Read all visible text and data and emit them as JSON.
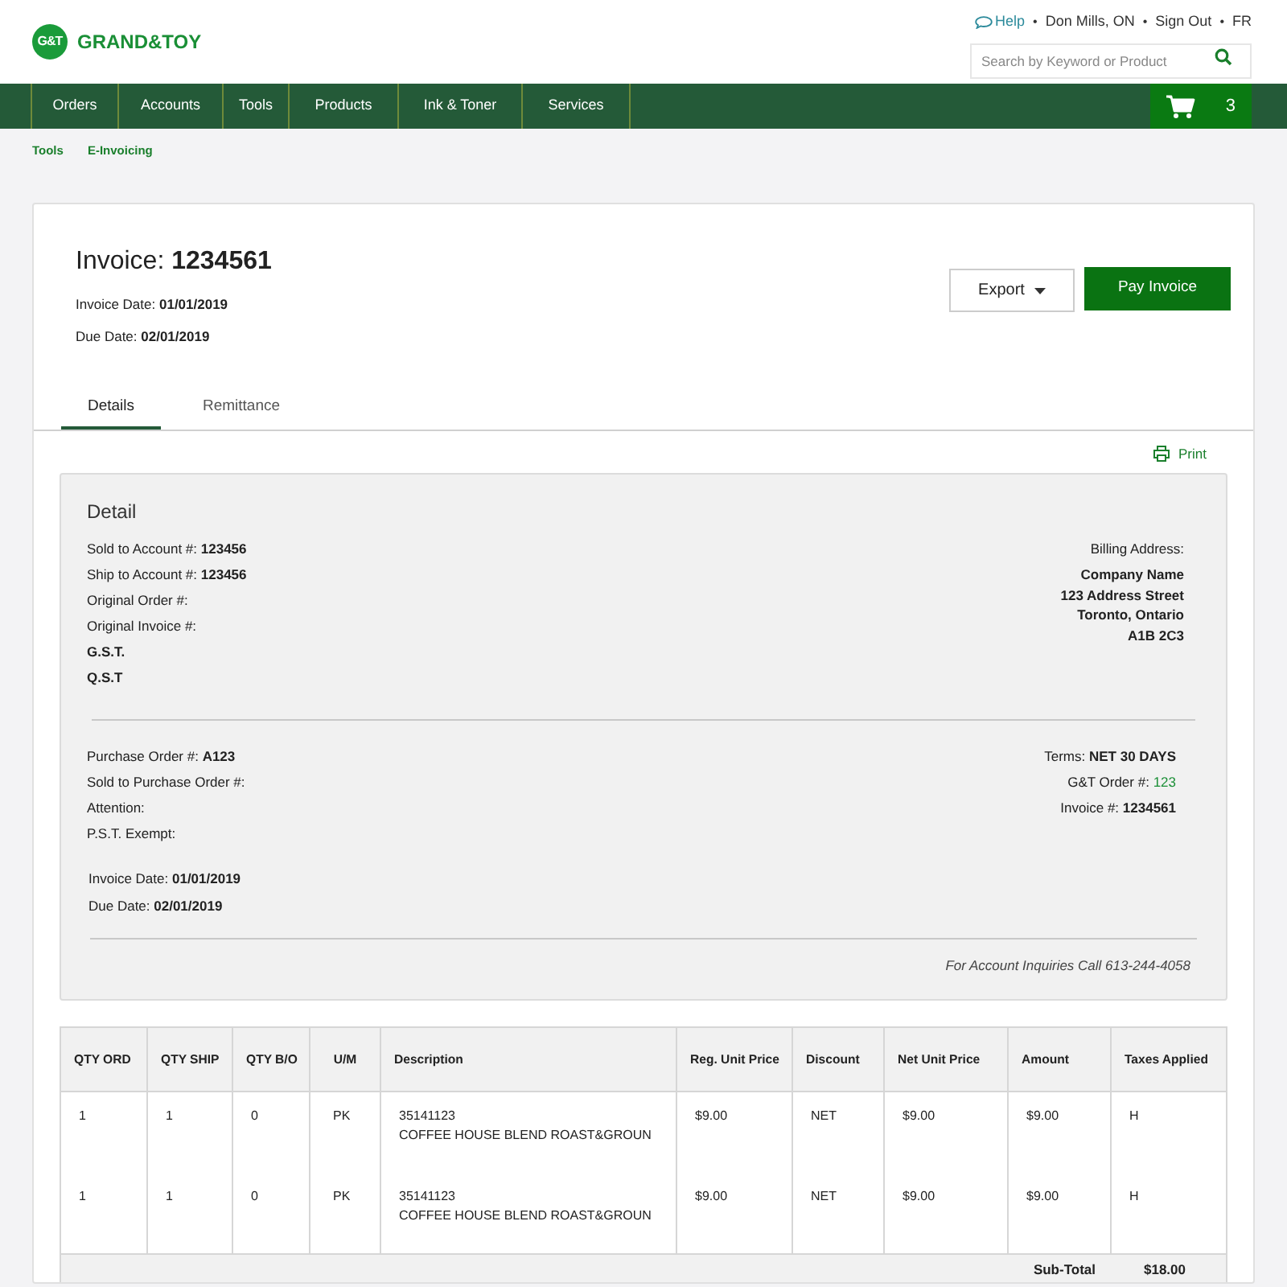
{
  "header": {
    "logo_mark": "G&T",
    "logo_text": "GRAND&TOY",
    "top_links": [
      {
        "label": "Help",
        "kind": "help"
      },
      {
        "label": "Don Mills, ON",
        "kind": "plain"
      },
      {
        "label": "Sign Out",
        "kind": "plain"
      },
      {
        "label": "FR",
        "kind": "plain"
      }
    ],
    "link_separator": "•",
    "search": {
      "placeholder": "Search by Keyword or Product"
    },
    "nav": [
      "Orders",
      "Accounts",
      "Tools",
      "Products",
      "Ink & Toner",
      "Services"
    ],
    "cart_count": "3"
  },
  "breadcrumbs": [
    "Tools",
    "E-Invoicing"
  ],
  "invoice": {
    "title_label": "Invoice:",
    "number": "1234561",
    "meta": [
      {
        "label": "Invoice Date:",
        "value": "01/01/2019"
      },
      {
        "label": "Due Date:",
        "value": "02/01/2019"
      }
    ],
    "export_button": "Export",
    "pay_button": "Pay Invoice",
    "tabs": [
      {
        "label": "Details",
        "selected": true
      },
      {
        "label": "Remittance",
        "selected": false
      }
    ],
    "print": "Print"
  },
  "detail": {
    "title": "Detail",
    "left_fields": [
      {
        "label": "Sold to Account #:",
        "value": "123456",
        "kind": "field"
      },
      {
        "label": "Ship to Account #:",
        "value": "123456",
        "kind": "field"
      },
      {
        "label": "Original Order #:",
        "kind": "field"
      },
      {
        "label": "Original Invoice #:",
        "kind": "field"
      },
      {
        "label": "G.S.T.",
        "kind": "heading"
      },
      {
        "label": "Q.S.T",
        "kind": "heading"
      }
    ],
    "billing_label": "Billing Address:",
    "billing_lines": [
      "Company Name",
      "123 Address Street",
      "Toronto, Ontario",
      "A1B 2C3"
    ],
    "order_fields": [
      {
        "label": "Purchase Order #:",
        "value": "A123",
        "kind": "field"
      },
      {
        "label": "Sold to Purchase Order #:",
        "kind": "field"
      },
      {
        "label": "Attention:",
        "kind": "field"
      },
      {
        "label": "P.S.T. Exempt:",
        "kind": "field"
      }
    ],
    "right_fields": [
      {
        "label": "Terms:",
        "value": "NET 30 DAYS",
        "kind": "field"
      },
      {
        "label": "G&T Order #:",
        "value": "123",
        "kind": "link"
      },
      {
        "label": "Invoice #:",
        "value": "1234561",
        "kind": "field"
      }
    ],
    "dates": [
      {
        "label": "Invoice Date:",
        "value": "01/01/2019",
        "kind": "field"
      },
      {
        "label": "Due Date:",
        "value": "02/01/2019",
        "kind": "field"
      }
    ],
    "note": "For Account Inquiries Call 613-244-4058"
  },
  "table": {
    "columns": [
      "QTY ORD",
      "QTY SHIP",
      "QTY B/O",
      "U/M",
      "Description",
      "Reg. Unit Price",
      "Discount",
      "Net Unit Price",
      "Amount",
      "Taxes Applied"
    ],
    "rows": [
      {
        "cells": [
          "1",
          "1",
          "0",
          "PK",
          [
            "35141123",
            "COFFEE HOUSE BLEND ROAST&GROUN"
          ],
          "$9.00",
          "NET",
          "$9.00",
          "$9.00",
          "H"
        ]
      },
      {
        "cells": [
          "1",
          "1",
          "0",
          "PK",
          [
            "35141123",
            "COFFEE HOUSE BLEND ROAST&GROUN"
          ],
          "$9.00",
          "NET",
          "$9.00",
          "$9.00",
          "H"
        ]
      }
    ],
    "subtotal_label": "Sub-Total",
    "subtotal_value": "$18.00"
  }
}
